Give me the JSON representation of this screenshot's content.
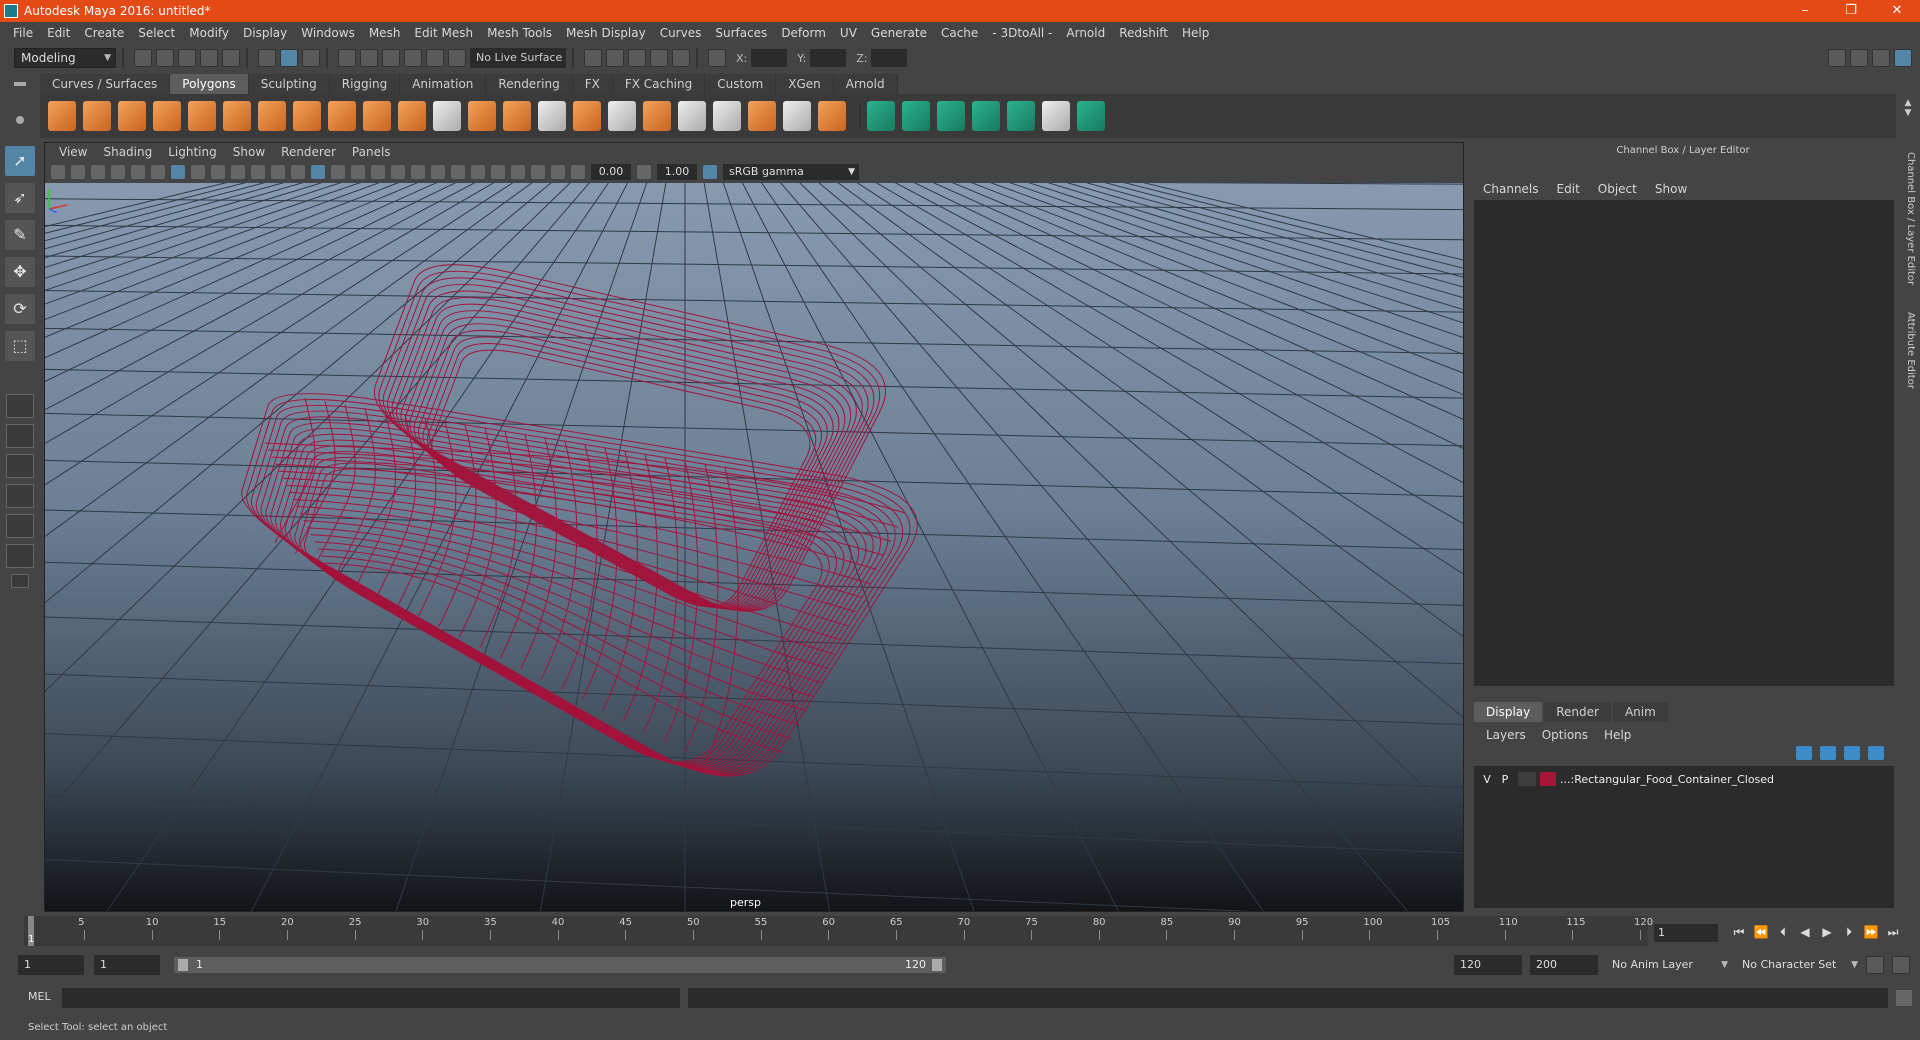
{
  "window": {
    "title": "Autodesk Maya 2016: untitled*",
    "buttons": [
      "–",
      "❐",
      "✕"
    ]
  },
  "menubar": [
    "File",
    "Edit",
    "Create",
    "Select",
    "Modify",
    "Display",
    "Windows",
    "Mesh",
    "Edit Mesh",
    "Mesh Tools",
    "Mesh Display",
    "Curves",
    "Surfaces",
    "Deform",
    "UV",
    "Generate",
    "Cache",
    "- 3DtoAll -",
    "Arnold",
    "Redshift",
    "Help"
  ],
  "statusline": {
    "mode": "Modeling",
    "live_surface": "No Live Surface",
    "x_label": "X:",
    "y_label": "Y:",
    "z_label": "Z:"
  },
  "shelf": {
    "tabs": [
      "Curves / Surfaces",
      "Polygons",
      "Sculpting",
      "Rigging",
      "Animation",
      "Rendering",
      "FX",
      "FX Caching",
      "Custom",
      "XGen",
      "Arnold"
    ],
    "active_tab": "Polygons"
  },
  "viewport": {
    "menu": [
      "View",
      "Shading",
      "Lighting",
      "Show",
      "Renderer",
      "Panels"
    ],
    "exposure": "0.00",
    "gamma": "1.00",
    "color_space": "sRGB gamma",
    "camera_label": "persp",
    "wire_color": "#a4123a"
  },
  "right_panel": {
    "title": "Channel Box / Layer Editor",
    "channel_menu": [
      "Channels",
      "Edit",
      "Object",
      "Show"
    ],
    "display_tabs": [
      "Display",
      "Render",
      "Anim"
    ],
    "active_display_tab": "Display",
    "layer_menu": [
      "Layers",
      "Options",
      "Help"
    ],
    "layer": {
      "v": "V",
      "p": "P",
      "name": "...:Rectangular_Food_Container_Closed",
      "color": "#a61535"
    },
    "side_tabs": [
      "Channel Box / Layer Editor",
      "Attribute Editor"
    ]
  },
  "timeslider": {
    "ticks": [
      "5",
      "10",
      "15",
      "20",
      "25",
      "30",
      "35",
      "40",
      "45",
      "50",
      "55",
      "60",
      "65",
      "70",
      "75",
      "80",
      "85",
      "90",
      "95",
      "100",
      "105",
      "110",
      "115",
      "120"
    ],
    "current": "1",
    "current_frame_field": "1"
  },
  "range": {
    "start": "1",
    "playback_start": "1",
    "slider_start": "1",
    "slider_end": "120",
    "playback_end": "120",
    "end": "200",
    "anim_layer": "No Anim Layer",
    "character_set": "No Character Set"
  },
  "cmdline": {
    "label": "MEL"
  },
  "helpline": {
    "text": "Select Tool: select an object"
  }
}
